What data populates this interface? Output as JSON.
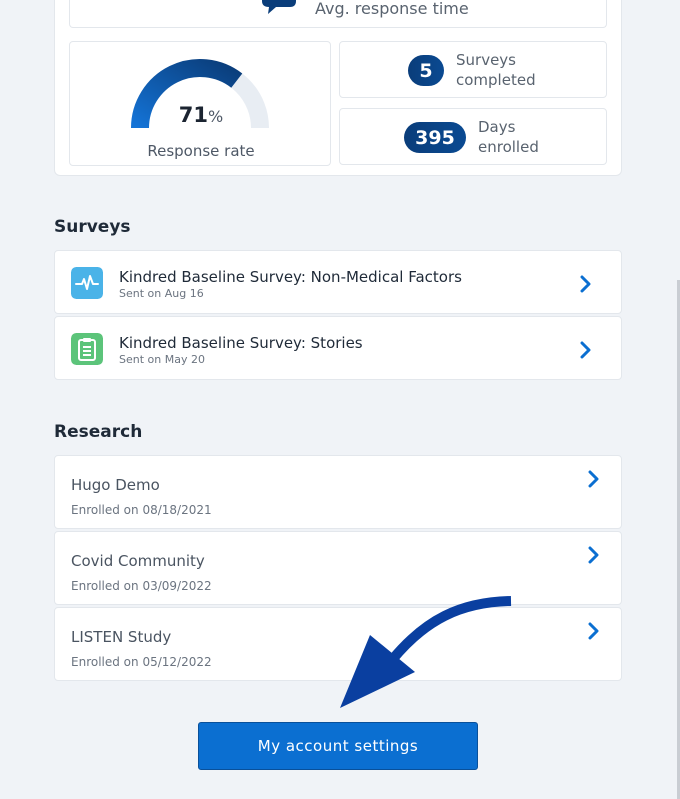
{
  "stats": {
    "avg_response_label": "Avg. response time",
    "response_rate": {
      "value": "71",
      "unit": "%",
      "label": "Response rate",
      "fraction": 0.71
    },
    "surveys_completed": {
      "value": "5",
      "label_line1": "Surveys",
      "label_line2": "completed"
    },
    "days_enrolled": {
      "value": "395",
      "label_line1": "Days",
      "label_line2": "enrolled"
    }
  },
  "surveys": {
    "heading": "Surveys",
    "items": [
      {
        "title": "Kindred Baseline Survey: Non-Medical Factors",
        "sent": "Sent on Aug 16",
        "icon": "heartbeat-icon",
        "icon_color": "#4ab3e8"
      },
      {
        "title": "Kindred Baseline Survey: Stories",
        "sent": "Sent on May 20",
        "icon": "clipboard-icon",
        "icon_color": "#5cc47a"
      }
    ]
  },
  "research": {
    "heading": "Research",
    "items": [
      {
        "title": "Hugo Demo",
        "enrolled": "Enrolled on 08/18/2021"
      },
      {
        "title": "Covid Community",
        "enrolled": "Enrolled on 03/09/2022"
      },
      {
        "title": "LISTEN Study",
        "enrolled": "Enrolled on 05/12/2022"
      }
    ]
  },
  "account_button_label": "My account settings",
  "colors": {
    "accent": "#0b6fd1",
    "dark_blue": "#0a3d7a",
    "chevron": "#0b6fd1",
    "arrow": "#0a3fa0"
  }
}
